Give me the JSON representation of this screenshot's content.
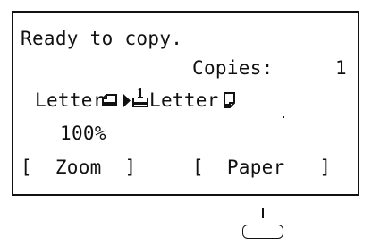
{
  "display": {
    "status_text": "Ready to copy.",
    "copies_label": "Copies:",
    "copies_value": "1",
    "original_size": "Letter",
    "output_size": "Letter",
    "zoom_value": "100%",
    "softkeys": {
      "zoom_label": "[  Zoom  ]",
      "paper_label": "[  Paper   ]"
    }
  },
  "icons": {
    "original_orientation": "landscape-original-icon",
    "feed_arrow": "arrow-right-icon",
    "paper_tray": "paper-tray-1-icon",
    "output_orientation": "portrait-paper-icon"
  }
}
